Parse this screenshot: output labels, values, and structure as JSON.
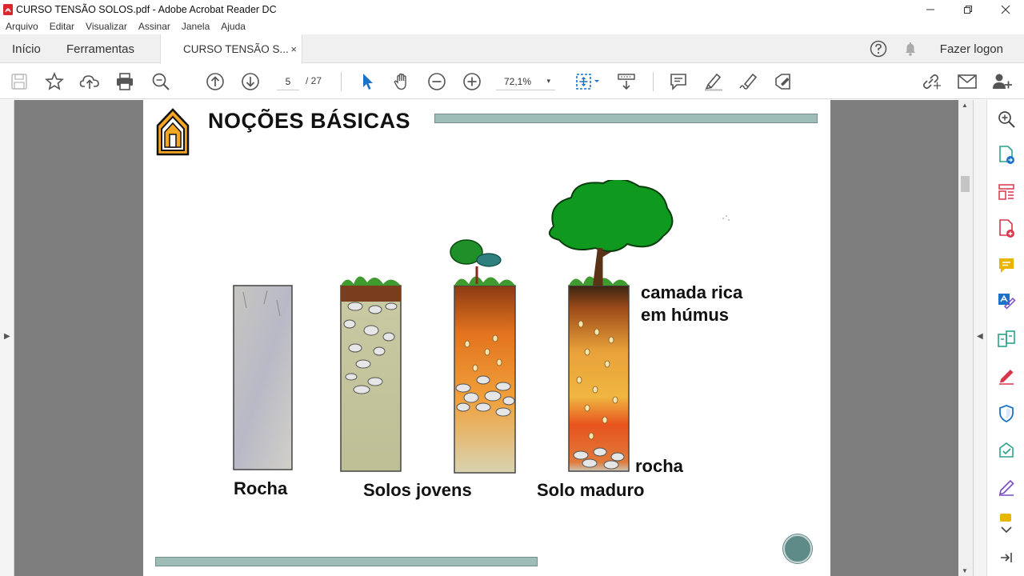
{
  "window": {
    "title": "CURSO TENSÃO SOLOS.pdf - Adobe Acrobat Reader DC"
  },
  "menu": [
    "Arquivo",
    "Editar",
    "Visualizar",
    "Assinar",
    "Janela",
    "Ajuda"
  ],
  "tabs": {
    "home": "Início",
    "tools": "Ferramentas",
    "document": "CURSO TENSÃO S...",
    "close_glyph": "×",
    "login": "Fazer logon"
  },
  "toolbar": {
    "current_page": "5",
    "page_total": "/  27",
    "zoom": "72,1%",
    "zoom_caret": "▾"
  },
  "page": {
    "heading": "NOÇÕES BÁSICAS",
    "labels": {
      "rock": "Rocha",
      "young": "Solos jovens",
      "mature": "Solo maduro",
      "humus_line1": "camada  rica",
      "humus_line2": "em húmus",
      "bedrock": "rocha"
    }
  },
  "colors": {
    "accent_bar": "#9ebdb6",
    "icon_blue": "#1a73c8",
    "icon_teal": "#2aa38a",
    "icon_red": "#d9354b",
    "icon_purple": "#7a4bc4",
    "icon_yellow": "#e8b500"
  }
}
